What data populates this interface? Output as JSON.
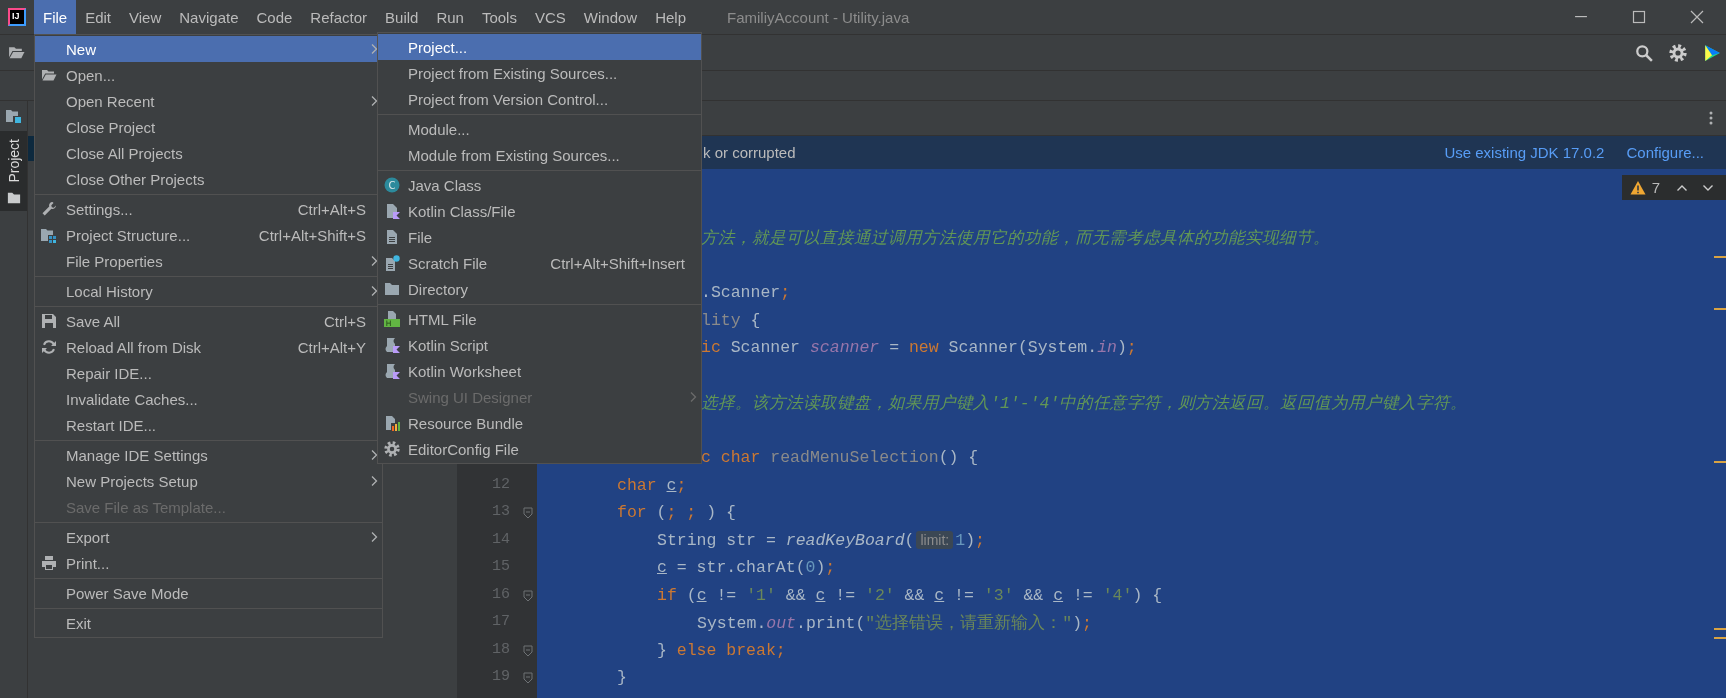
{
  "app": {
    "logo_text": "IJ",
    "title": "FamiliyAccount - Utility.java"
  },
  "menu_bar": [
    {
      "label": "File",
      "selected": true
    },
    {
      "label": "Edit",
      "selected": false
    },
    {
      "label": "View",
      "selected": false
    },
    {
      "label": "Navigate",
      "selected": false
    },
    {
      "label": "Code",
      "selected": false
    },
    {
      "label": "Refactor",
      "selected": false
    },
    {
      "label": "Build",
      "selected": false
    },
    {
      "label": "Run",
      "selected": false
    },
    {
      "label": "Tools",
      "selected": false
    },
    {
      "label": "VCS",
      "selected": false
    },
    {
      "label": "Window",
      "selected": false
    },
    {
      "label": "Help",
      "selected": false
    }
  ],
  "file_menu": {
    "groups": [
      [
        {
          "label": "New",
          "selected": true,
          "disabled": false,
          "has_submenu": true
        },
        {
          "label": "Open...",
          "selected": false,
          "disabled": false,
          "has_submenu": false
        },
        {
          "label": "Open Recent",
          "selected": false,
          "disabled": false,
          "has_submenu": true
        },
        {
          "label": "Close Project",
          "selected": false,
          "disabled": false,
          "has_submenu": false
        },
        {
          "label": "Close All Projects",
          "selected": false,
          "disabled": false,
          "has_submenu": false
        },
        {
          "label": "Close Other Projects",
          "selected": false,
          "disabled": false,
          "has_submenu": false
        }
      ],
      [
        {
          "label": "Settings...",
          "shortcut": "Ctrl+Alt+S",
          "selected": false,
          "disabled": false,
          "has_submenu": false
        },
        {
          "label": "Project Structure...",
          "shortcut": "Ctrl+Alt+Shift+S",
          "selected": false,
          "disabled": false,
          "has_submenu": false
        },
        {
          "label": "File Properties",
          "selected": false,
          "disabled": false,
          "has_submenu": true
        }
      ],
      [
        {
          "label": "Local History",
          "selected": false,
          "disabled": false,
          "has_submenu": true
        }
      ],
      [
        {
          "label": "Save All",
          "shortcut": "Ctrl+S",
          "selected": false,
          "disabled": false,
          "has_submenu": false
        },
        {
          "label": "Reload All from Disk",
          "shortcut": "Ctrl+Alt+Y",
          "selected": false,
          "disabled": false,
          "has_submenu": false
        },
        {
          "label": "Repair IDE...",
          "selected": false,
          "disabled": false,
          "has_submenu": false
        },
        {
          "label": "Invalidate Caches...",
          "selected": false,
          "disabled": false,
          "has_submenu": false
        },
        {
          "label": "Restart IDE...",
          "selected": false,
          "disabled": false,
          "has_submenu": false
        }
      ],
      [
        {
          "label": "Manage IDE Settings",
          "selected": false,
          "disabled": false,
          "has_submenu": true
        },
        {
          "label": "New Projects Setup",
          "selected": false,
          "disabled": false,
          "has_submenu": true
        },
        {
          "label": "Save File as Template...",
          "selected": false,
          "disabled": true,
          "has_submenu": false
        }
      ],
      [
        {
          "label": "Export",
          "selected": false,
          "disabled": false,
          "has_submenu": true
        },
        {
          "label": "Print...",
          "selected": false,
          "disabled": false,
          "has_submenu": false
        }
      ],
      [
        {
          "label": "Power Save Mode",
          "selected": false,
          "disabled": false,
          "has_submenu": false
        }
      ],
      [
        {
          "label": "Exit",
          "selected": false,
          "disabled": false,
          "has_submenu": false
        }
      ]
    ]
  },
  "new_submenu": {
    "groups": [
      [
        {
          "label": "Project...",
          "selected": true,
          "disabled": false,
          "has_submenu": false
        },
        {
          "label": "Project from Existing Sources...",
          "selected": false,
          "disabled": false,
          "has_submenu": false
        },
        {
          "label": "Project from Version Control...",
          "selected": false,
          "disabled": false,
          "has_submenu": false
        }
      ],
      [
        {
          "label": "Module...",
          "selected": false,
          "disabled": false,
          "has_submenu": false
        },
        {
          "label": "Module from Existing Sources...",
          "selected": false,
          "disabled": false,
          "has_submenu": false
        }
      ],
      [
        {
          "label": "Java Class",
          "badge": "C",
          "selected": false,
          "disabled": false,
          "has_submenu": false
        },
        {
          "label": "Kotlin Class/File",
          "selected": false,
          "disabled": false,
          "has_submenu": false
        },
        {
          "label": "File",
          "selected": false,
          "disabled": false,
          "has_submenu": false
        },
        {
          "label": "Scratch File",
          "shortcut": "Ctrl+Alt+Shift+Insert",
          "selected": false,
          "disabled": false,
          "has_submenu": false
        },
        {
          "label": "Directory",
          "selected": false,
          "disabled": false,
          "has_submenu": false
        }
      ],
      [
        {
          "label": "HTML File",
          "badge": "H",
          "selected": false,
          "disabled": false,
          "has_submenu": false
        },
        {
          "label": "Kotlin Script",
          "selected": false,
          "disabled": false,
          "has_submenu": false
        },
        {
          "label": "Kotlin Worksheet",
          "selected": false,
          "disabled": false,
          "has_submenu": false
        },
        {
          "label": "Swing UI Designer",
          "selected": false,
          "disabled": true,
          "has_submenu": true
        },
        {
          "label": "Resource Bundle",
          "selected": false,
          "disabled": false,
          "has_submenu": false
        },
        {
          "label": "EditorConfig File",
          "selected": false,
          "disabled": false,
          "has_submenu": false
        }
      ]
    ]
  },
  "tool_window": {
    "label": "Project",
    "selected": true
  },
  "notification": {
    "message": "k or corrupted",
    "links": [
      "Use existing JDK 17.0.2",
      "Configure..."
    ]
  },
  "inspections": {
    "warnings": "7"
  },
  "editor": {
    "lines": [
      {
        "tokens": [
          {
            "kind": "comment",
            "text": "方法，就是可以直接通过调用方法使用它的功能，而无需考虑具体的功能实现细节。"
          }
        ]
      },
      {
        "tokens": [
          {
            "kind": "plain",
            "text": ".Scanner"
          },
          {
            "kind": "keyword",
            "text": ";"
          }
        ]
      },
      {
        "tokens": [
          {
            "kind": "dim",
            "text": "lity"
          },
          {
            "kind": "plain",
            "text": " {"
          }
        ]
      },
      {
        "tokens": [
          {
            "kind": "keyword",
            "text": "ic"
          },
          {
            "kind": "plain",
            "text": " Scanner "
          },
          {
            "kind": "field",
            "text": "scanner"
          },
          {
            "kind": "plain",
            "text": " = "
          },
          {
            "kind": "keyword",
            "text": "new"
          },
          {
            "kind": "plain",
            "text": " Scanner(System."
          },
          {
            "kind": "field",
            "text": "in"
          },
          {
            "kind": "plain",
            "text": ")"
          },
          {
            "kind": "keyword",
            "text": ";"
          }
        ]
      },
      {
        "tokens": [
          {
            "kind": "comment",
            "text": "选择。该方法读取键盘，如果用户键入'1'-'4'中的任意字符，则方法返回。返回值为用户键入字符。"
          }
        ]
      },
      {
        "tokens": [
          {
            "kind": "keyword",
            "text": "c char "
          },
          {
            "kind": "dim",
            "text": "readMenuSelection"
          },
          {
            "kind": "plain",
            "text": "() {"
          }
        ]
      },
      {
        "number": "12",
        "tokens": [
          {
            "kind": "keyword",
            "text": "char "
          },
          {
            "kind": "var",
            "text": "c"
          },
          {
            "kind": "keyword",
            "text": ";"
          }
        ]
      },
      {
        "number": "13",
        "tokens": [
          {
            "kind": "keyword",
            "text": "for"
          },
          {
            "kind": "plain",
            "text": " ("
          },
          {
            "kind": "keyword",
            "text": "; ; "
          },
          {
            "kind": "plain",
            "text": ") {"
          }
        ]
      },
      {
        "number": "14",
        "tokens": [
          {
            "kind": "plain",
            "text": "String str = "
          },
          {
            "kind": "call",
            "text": "readKeyBoard"
          },
          {
            "kind": "plain",
            "text": "("
          },
          {
            "kind": "hint",
            "text": "limit:"
          },
          {
            "kind": "number",
            "text": "1"
          },
          {
            "kind": "plain",
            "text": ")"
          },
          {
            "kind": "keyword",
            "text": ";"
          }
        ]
      },
      {
        "number": "15",
        "tokens": [
          {
            "kind": "var",
            "text": "c"
          },
          {
            "kind": "plain",
            "text": " = str.charAt("
          },
          {
            "kind": "number",
            "text": "0"
          },
          {
            "kind": "plain",
            "text": ")"
          },
          {
            "kind": "keyword",
            "text": ";"
          }
        ]
      },
      {
        "number": "16",
        "tokens": [
          {
            "kind": "keyword",
            "text": "if"
          },
          {
            "kind": "plain",
            "text": " ("
          },
          {
            "kind": "var",
            "text": "c"
          },
          {
            "kind": "plain",
            "text": " != "
          },
          {
            "kind": "string",
            "text": "'1'"
          },
          {
            "kind": "plain",
            "text": " && "
          },
          {
            "kind": "var",
            "text": "c"
          },
          {
            "kind": "plain",
            "text": " != "
          },
          {
            "kind": "string",
            "text": "'2'"
          },
          {
            "kind": "plain",
            "text": " && "
          },
          {
            "kind": "var",
            "text": "c"
          },
          {
            "kind": "plain",
            "text": " != "
          },
          {
            "kind": "string",
            "text": "'3'"
          },
          {
            "kind": "plain",
            "text": " && "
          },
          {
            "kind": "var",
            "text": "c"
          },
          {
            "kind": "plain",
            "text": " != "
          },
          {
            "kind": "string",
            "text": "'4'"
          },
          {
            "kind": "plain",
            "text": ") {"
          }
        ]
      },
      {
        "number": "17",
        "tokens": [
          {
            "kind": "plain",
            "text": "System."
          },
          {
            "kind": "field",
            "text": "out"
          },
          {
            "kind": "plain",
            "text": ".print("
          },
          {
            "kind": "string",
            "text": "\"选择错误，请重新输入：\""
          },
          {
            "kind": "plain",
            "text": ")"
          },
          {
            "kind": "keyword",
            "text": ";"
          }
        ]
      },
      {
        "number": "18",
        "tokens": [
          {
            "kind": "plain",
            "text": "} "
          },
          {
            "kind": "keyword",
            "text": "else break;"
          }
        ]
      },
      {
        "number": "19",
        "tokens": [
          {
            "kind": "plain",
            "text": "}"
          }
        ]
      }
    ]
  }
}
